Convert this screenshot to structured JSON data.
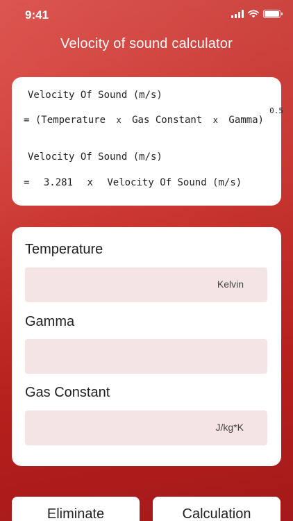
{
  "status_bar": {
    "time": "9:41"
  },
  "header": {
    "title": "Velocity of sound calculator"
  },
  "formula": {
    "line1": "Velocity Of Sound (m/s)",
    "line2_open": "= (Temperature",
    "line2_mul1": "x",
    "line2_mid": "Gas Constant",
    "line2_mul2": "x",
    "line2_close": "Gamma)",
    "line2_exponent": "0.5",
    "line3": "Velocity Of Sound (m/s)",
    "line4_eq": "=",
    "line4_value": "3.281",
    "line4_mul": "x",
    "line4_rest": "Velocity Of Sound (m/s)"
  },
  "fields": {
    "temperature": {
      "label": "Temperature",
      "value": "",
      "unit": "Kelvin"
    },
    "gamma": {
      "label": "Gamma",
      "value": "",
      "unit": ""
    },
    "gas_constant": {
      "label": "Gas Constant",
      "value": "",
      "unit": "J/kg*K"
    }
  },
  "buttons": {
    "eliminate": "Eliminate",
    "calculation": "Calculation"
  },
  "colors": {
    "background": "#cf3b36",
    "card": "#ffffff",
    "input_bg": "#f4e4e4"
  }
}
